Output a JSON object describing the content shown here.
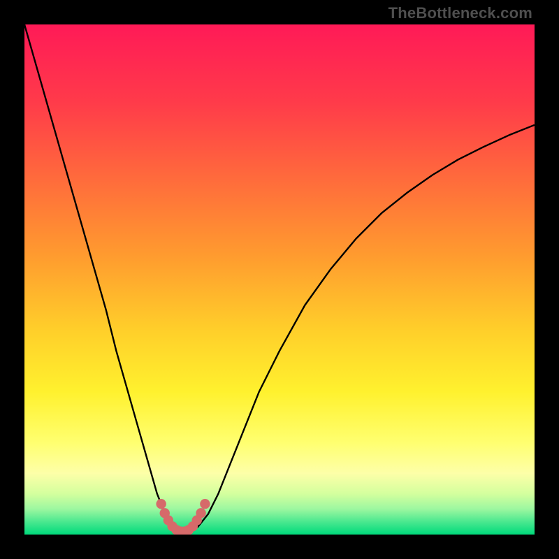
{
  "watermark": "TheBottleneck.com",
  "chart_data": {
    "type": "line",
    "title": "",
    "xlabel": "",
    "ylabel": "",
    "xlim": [
      0,
      100
    ],
    "ylim": [
      0,
      100
    ],
    "grid": false,
    "legend": false,
    "annotations": [],
    "series": [
      {
        "name": "curve",
        "color": "#000000",
        "x": [
          0,
          2,
          4,
          6,
          8,
          10,
          12,
          14,
          16,
          18,
          20,
          22,
          24,
          26,
          28,
          29,
          30,
          31,
          32,
          33,
          34,
          36,
          38,
          40,
          42,
          44,
          46,
          48,
          50,
          55,
          60,
          65,
          70,
          75,
          80,
          85,
          90,
          95,
          100
        ],
        "y": [
          100,
          93,
          86,
          79,
          72,
          65,
          58,
          51,
          44,
          36,
          29,
          22,
          15,
          8,
          3,
          1.5,
          0.8,
          0.5,
          0.5,
          0.8,
          1.5,
          4,
          8,
          13,
          18,
          23,
          28,
          32,
          36,
          45,
          52,
          58,
          63,
          67,
          70.5,
          73.5,
          76,
          78.3,
          80.3
        ]
      },
      {
        "name": "highlight",
        "color": "#d66a6a",
        "x": [
          26.8,
          27.5,
          28.2,
          29,
          29.8,
          30.6,
          31.4,
          32.2,
          33,
          33.8,
          34.6,
          35.4
        ],
        "y": [
          6,
          4.2,
          2.8,
          1.6,
          0.9,
          0.6,
          0.6,
          0.9,
          1.6,
          2.8,
          4.2,
          6
        ]
      }
    ],
    "background_gradient": {
      "type": "vertical",
      "stops": [
        {
          "offset": 0.0,
          "color": "#ff1a57"
        },
        {
          "offset": 0.15,
          "color": "#ff3a4a"
        },
        {
          "offset": 0.3,
          "color": "#ff6a3c"
        },
        {
          "offset": 0.45,
          "color": "#ff9a2f"
        },
        {
          "offset": 0.6,
          "color": "#ffcf2a"
        },
        {
          "offset": 0.72,
          "color": "#fff12e"
        },
        {
          "offset": 0.82,
          "color": "#ffff70"
        },
        {
          "offset": 0.88,
          "color": "#fdffa8"
        },
        {
          "offset": 0.92,
          "color": "#d4ff9e"
        },
        {
          "offset": 0.95,
          "color": "#9cf7a0"
        },
        {
          "offset": 0.975,
          "color": "#4ae88f"
        },
        {
          "offset": 1.0,
          "color": "#00da7b"
        }
      ]
    }
  }
}
